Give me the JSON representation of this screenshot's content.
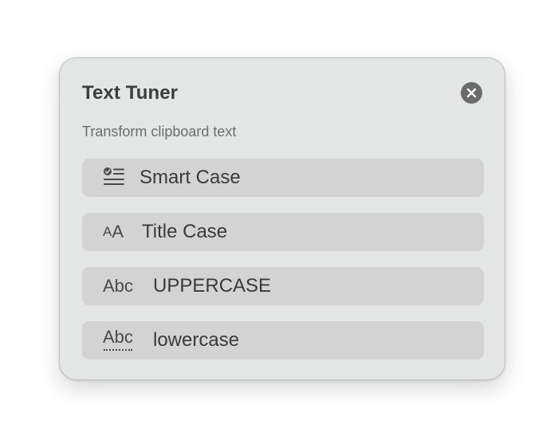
{
  "window": {
    "title": "Text Tuner",
    "subtitle": "Transform clipboard text",
    "close_icon": "xmark-circle-icon"
  },
  "options": [
    {
      "label": "Smart Case",
      "icon": "smart-case-checklist-icon",
      "icon_text": ""
    },
    {
      "label": "Title Case",
      "icon": "text-size-icon",
      "icon_small": "A",
      "icon_large": "A"
    },
    {
      "label": "UPPERCASE",
      "icon": "abc-icon",
      "icon_text": "Abc"
    },
    {
      "label": "lowercase",
      "icon": "abc-dotted-underline-icon",
      "icon_text": "Abc"
    }
  ],
  "colors": {
    "panel_background": "#e4e5e5",
    "option_background": "#d3d3d3",
    "close_button": "#6b6b6b",
    "text_primary": "#3d3d3d",
    "text_secondary": "#6e6e6e"
  }
}
